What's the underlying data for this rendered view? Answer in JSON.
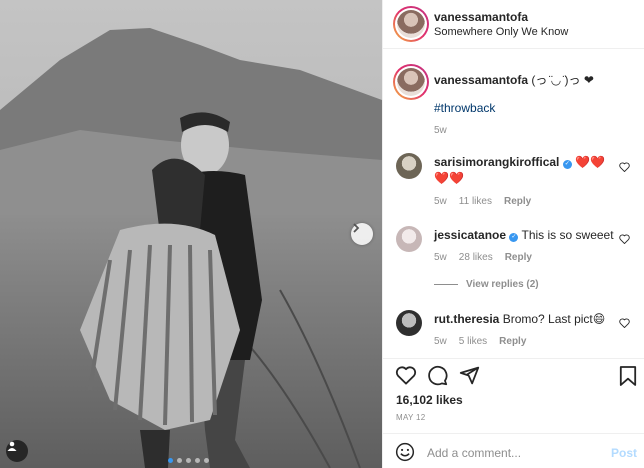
{
  "post": {
    "username": "vanessamantofa",
    "location": "Somewhere Only We Know",
    "caption_user": "vanessamantofa",
    "caption_text": "(っ ̈◡ ̈)っ ❤",
    "hashtag": "#throwback",
    "caption_time": "5w",
    "carousel": {
      "slide_count": 5,
      "active_slide": 1
    }
  },
  "comments": [
    {
      "username": "sarisimorangkiroffical",
      "verified": true,
      "text": "❤️❤️❤️❤️",
      "time": "5w",
      "likes": "11 likes",
      "reply": "Reply"
    },
    {
      "username": "jessicatanoe",
      "verified": true,
      "text": "This is so sweeet",
      "time": "5w",
      "likes": "28 likes",
      "reply": "Reply"
    },
    {
      "username": "rut.theresia",
      "verified": false,
      "text": "Bromo? Last pict😄",
      "time": "5w",
      "likes": "5 likes",
      "reply": "Reply"
    }
  ],
  "view_replies": "View replies (2)",
  "footer": {
    "likes": "16,102 likes",
    "date": "MAY 12",
    "comment_placeholder": "Add a comment...",
    "post_button": "Post"
  },
  "icons": {
    "like": "heart-icon",
    "comment": "comment-icon",
    "share": "share-icon",
    "save": "bookmark-icon",
    "emoji": "emoji-icon",
    "next": "chevron-right-icon",
    "tag": "user-tag-icon"
  },
  "colors": {
    "link": "#00376b",
    "verified": "#3897f0",
    "heart": "#e0245e",
    "muted": "#8e8e8e"
  }
}
